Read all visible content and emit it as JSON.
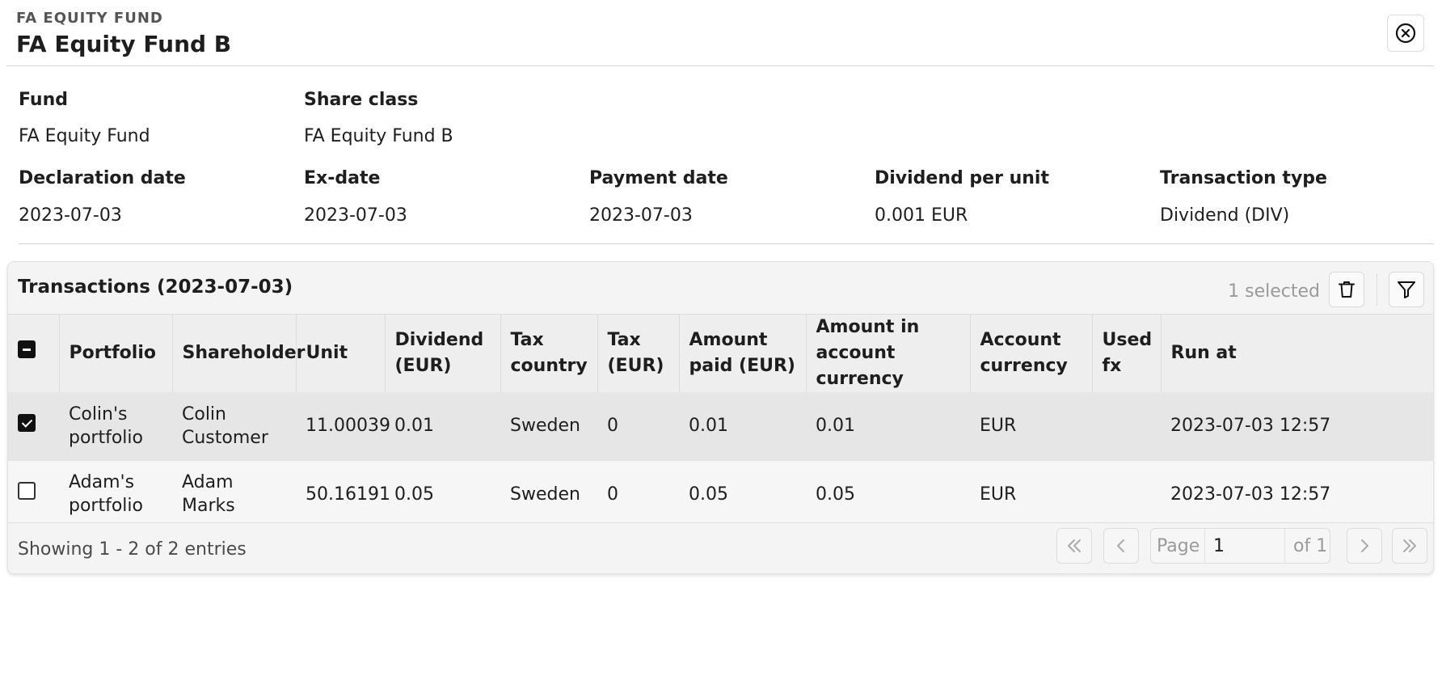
{
  "header": {
    "overline": "FA EQUITY FUND",
    "title": "FA Equity Fund B",
    "close_icon": "close-circle-icon"
  },
  "details": {
    "fund_label": "Fund",
    "fund_value": "FA Equity Fund",
    "share_class_label": "Share class",
    "share_class_value": "FA Equity Fund B",
    "declaration_date_label": "Declaration date",
    "declaration_date_value": "2023-07-03",
    "ex_date_label": "Ex-date",
    "ex_date_value": "2023-07-03",
    "payment_date_label": "Payment date",
    "payment_date_value": "2023-07-03",
    "dividend_per_unit_label": "Dividend per unit",
    "dividend_per_unit_value": "0.001 EUR",
    "transaction_type_label": "Transaction type",
    "transaction_type_value": "Dividend (DIV)"
  },
  "transactions": {
    "title": "Transactions (2023-07-03)",
    "selected_text": "1 selected",
    "delete_icon": "trash-icon",
    "filter_icon": "filter-icon",
    "columns": {
      "portfolio": "Portfolio",
      "shareholder": "Shareholder",
      "unit": "Unit",
      "dividend": "Dividend (EUR)",
      "tax_country": "Tax country",
      "tax": "Tax (EUR)",
      "amount_paid": "Amount paid (EUR)",
      "amount_account": "Amount in account currency",
      "account_currency": "Account currency",
      "used_fx": "Used fx",
      "run_at": "Run at"
    },
    "rows": [
      {
        "selected": true,
        "portfolio": "Colin's portfolio",
        "shareholder": "Colin Customer",
        "unit": "11.00039",
        "dividend": "0.01",
        "tax_country": "Sweden",
        "tax": "0",
        "amount_paid": "0.01",
        "amount_account": "0.01",
        "account_currency": "EUR",
        "used_fx": "",
        "run_at": "2023-07-03 12:57"
      },
      {
        "selected": false,
        "portfolio": "Adam's portfolio",
        "shareholder": "Adam Marks",
        "unit": "50.16191",
        "dividend": "0.05",
        "tax_country": "Sweden",
        "tax": "0",
        "amount_paid": "0.05",
        "amount_account": "0.05",
        "account_currency": "EUR",
        "used_fx": "",
        "run_at": "2023-07-03 12:57"
      }
    ],
    "footer": {
      "showing": "Showing 1 - 2 of 2 entries",
      "page_label": "Page",
      "page_value": "1",
      "page_of": "of 1"
    }
  }
}
